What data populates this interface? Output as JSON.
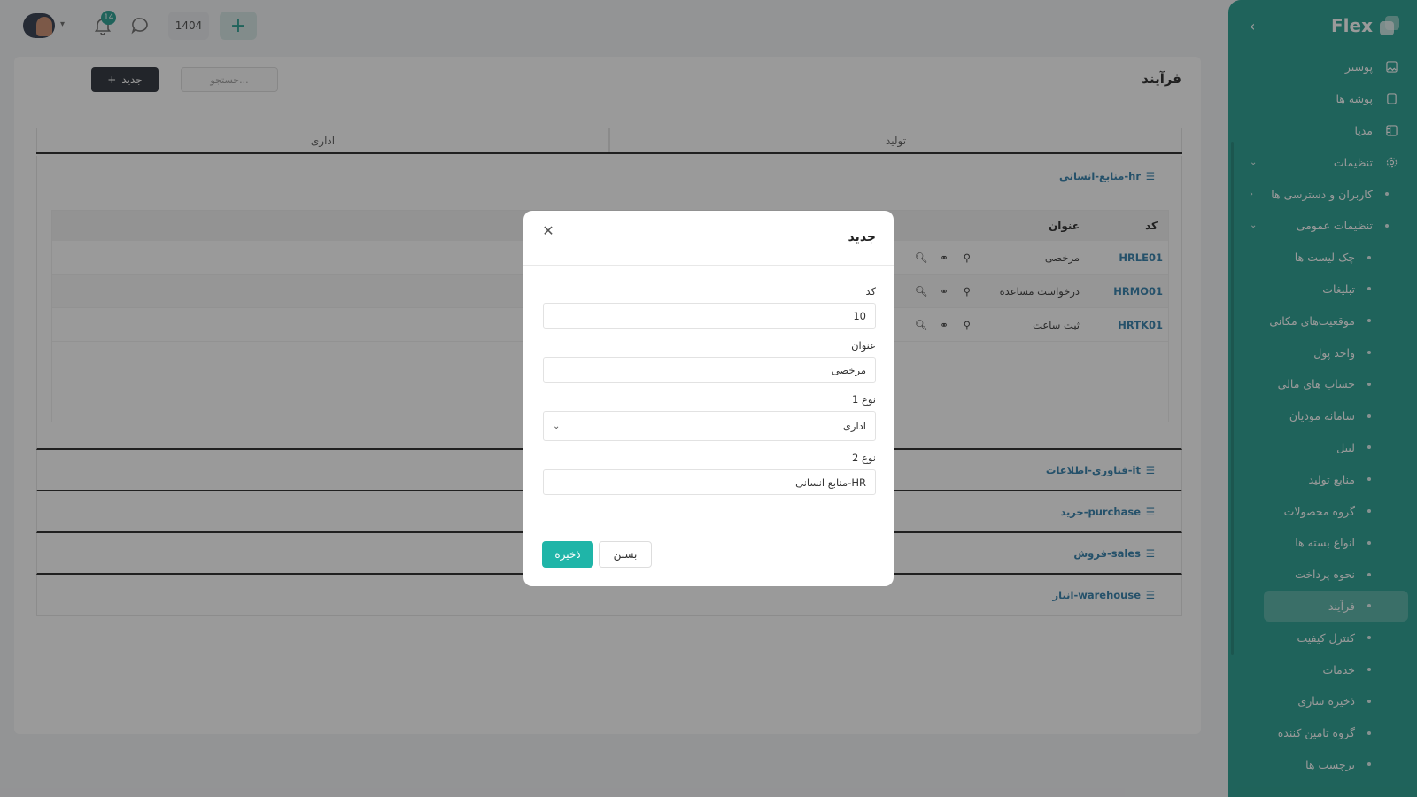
{
  "sidebar": {
    "brand": "Flex",
    "items": [
      {
        "label": "پوستر",
        "icon": "poster-icon",
        "level": 0
      },
      {
        "label": "پوشه ها",
        "icon": "folder-icon",
        "level": 0
      },
      {
        "label": "مدیا",
        "icon": "media-icon",
        "level": 0
      },
      {
        "label": "تنظیمات",
        "icon": "settings-icon",
        "level": 0,
        "expanded": true
      },
      {
        "label": "کاربران و دسترسی ها",
        "level": 1,
        "collapsed": true
      },
      {
        "label": "تنظیمات عمومی",
        "level": 1,
        "expanded": true
      },
      {
        "label": "چک لیست ها",
        "level": 2
      },
      {
        "label": "تبلیغات",
        "level": 2
      },
      {
        "label": "موقعیت‌های مکانی",
        "level": 2
      },
      {
        "label": "واحد پول",
        "level": 2
      },
      {
        "label": "حساب های مالی",
        "level": 2
      },
      {
        "label": "سامانه مودیان",
        "level": 2
      },
      {
        "label": "لیبل",
        "level": 2
      },
      {
        "label": "منابع تولید",
        "level": 2
      },
      {
        "label": "گروه محصولات",
        "level": 2
      },
      {
        "label": "انواع بسته ها",
        "level": 2
      },
      {
        "label": "نحوه پرداخت",
        "level": 2
      },
      {
        "label": "فرآیند",
        "level": 2,
        "active": true
      },
      {
        "label": "کنترل کیفیت",
        "level": 2
      },
      {
        "label": "خدمات",
        "level": 2
      },
      {
        "label": "ذخیره سازی",
        "level": 2
      },
      {
        "label": "گروه تامین کننده",
        "level": 2
      },
      {
        "label": "برچسب ها",
        "level": 2
      }
    ]
  },
  "topbar": {
    "year": "1404",
    "notification_count": "14"
  },
  "page": {
    "title": "فرآیند",
    "new_button_label": "جدید",
    "search_placeholder": "جستجو..."
  },
  "tabs": [
    {
      "label": "تولید"
    },
    {
      "label": "اداری"
    }
  ],
  "groups": [
    {
      "label": "hr-منابع-انسانی",
      "expanded": true,
      "table": {
        "columns": [
          "کد",
          "عنوان"
        ],
        "rows": [
          {
            "code": "HRLE01",
            "title": "مرخصی"
          },
          {
            "code": "HRMO01",
            "title": "درخواست مساعده"
          },
          {
            "code": "HRTK01",
            "title": "ثبت ساعت"
          }
        ]
      }
    },
    {
      "label": "it-فناوری-اطلاعات"
    },
    {
      "label": "purchase-خرید"
    },
    {
      "label": "sales-فروش"
    },
    {
      "label": "warehouse-انبار"
    }
  ],
  "modal": {
    "title": "جدید",
    "fields": {
      "code": {
        "label": "کد",
        "value": "10"
      },
      "title": {
        "label": "عنوان",
        "value": "مرخصی"
      },
      "type1": {
        "label": "نوع 1",
        "value": "اداری"
      },
      "type2": {
        "label": "نوع 2",
        "value": "HR-منابع انسانی"
      }
    },
    "save_label": "ذخیره",
    "close_label": "بستن"
  },
  "colors": {
    "sidebar": "#1f9b8c",
    "accent": "#1fb5a8",
    "link": "#2a7aa8",
    "dark_button": "#262b33"
  }
}
